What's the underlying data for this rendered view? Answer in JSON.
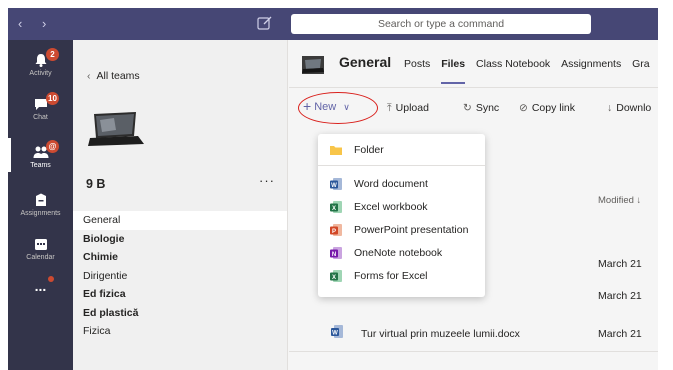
{
  "titlebar": {
    "back_arrow": "‹",
    "forward_arrow": "›",
    "search_placeholder": "Search or type a command"
  },
  "rail": [
    {
      "id": "activity",
      "label": "Activity",
      "badge": "2",
      "icon": "bell-icon"
    },
    {
      "id": "chat",
      "label": "Chat",
      "badge": "10",
      "icon": "chat-icon"
    },
    {
      "id": "teams",
      "label": "Teams",
      "badge": "@",
      "icon": "teams-icon",
      "active": true
    },
    {
      "id": "assignments",
      "label": "Assignments",
      "icon": "assignments-icon"
    },
    {
      "id": "calendar",
      "label": "Calendar",
      "icon": "calendar-icon"
    },
    {
      "id": "more",
      "label": "...",
      "icon": "more-icon"
    }
  ],
  "teams_panel": {
    "back_label": "All teams",
    "team_name": "9 B",
    "more": "···",
    "channels": [
      {
        "name": "General",
        "bold": false,
        "selected": true
      },
      {
        "name": "Biologie",
        "bold": true
      },
      {
        "name": "Chimie",
        "bold": true
      },
      {
        "name": "Dirigentie",
        "bold": false
      },
      {
        "name": "Ed fizica",
        "bold": true
      },
      {
        "name": "Ed plastică",
        "bold": true
      },
      {
        "name": "Fizica",
        "bold": false
      }
    ]
  },
  "header": {
    "title": "General",
    "tabs": [
      "Posts",
      "Files",
      "Class Notebook",
      "Assignments",
      "Gra"
    ],
    "active_tab": "Files"
  },
  "toolbar": {
    "new_label": "New",
    "upload_label": "Upload",
    "sync_label": "Sync",
    "copy_link_label": "Copy link",
    "download_label": "Downlo"
  },
  "files": {
    "modified_header": "Modified ↓",
    "dates": [
      "March 21",
      "March 21"
    ],
    "visible_row": {
      "name": "Tur virtual prin muzeele lumii.docx",
      "modified": "March 21"
    }
  },
  "new_menu": {
    "items": [
      {
        "label": "Folder",
        "icon": "folder-icon",
        "color": "#f8c549"
      },
      {
        "label": "Word document",
        "icon": "word-icon",
        "color": "#2b579a"
      },
      {
        "label": "Excel workbook",
        "icon": "excel-icon",
        "color": "#217346"
      },
      {
        "label": "PowerPoint presentation",
        "icon": "powerpoint-icon",
        "color": "#d24726"
      },
      {
        "label": "OneNote notebook",
        "icon": "onenote-icon",
        "color": "#7719aa"
      },
      {
        "label": "Forms for Excel",
        "icon": "forms-excel-icon",
        "color": "#217346"
      }
    ]
  },
  "colors": {
    "titlebar": "#464775",
    "rail": "#33344a",
    "accent": "#6264a7",
    "badge": "#cc4a31",
    "highlight_ring": "#d9201c"
  }
}
